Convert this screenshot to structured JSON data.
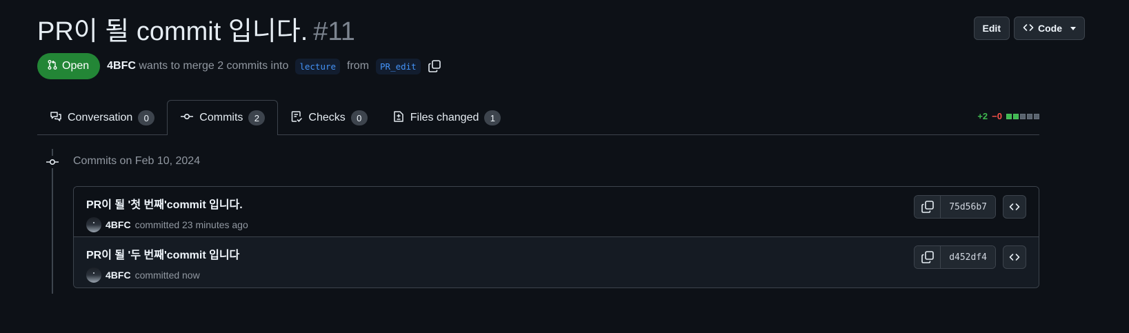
{
  "pr": {
    "title": "PR이 될 commit 입니다.",
    "number": "#11",
    "state_label": "Open",
    "author": "4BFC",
    "merge_text": "wants to merge 2 commits into",
    "base_branch": "lecture",
    "from_text": "from",
    "head_branch": "PR_edit"
  },
  "header_actions": {
    "edit_label": "Edit",
    "code_label": "Code"
  },
  "tabs": [
    {
      "label": "Conversation",
      "count": "0",
      "icon": "comment-discussion-icon"
    },
    {
      "label": "Commits",
      "count": "2",
      "icon": "git-commit-icon",
      "active": true
    },
    {
      "label": "Checks",
      "count": "0",
      "icon": "checklist-icon"
    },
    {
      "label": "Files changed",
      "count": "1",
      "icon": "file-diff-icon"
    }
  ],
  "diffstat": {
    "additions": "+2",
    "deletions": "−0",
    "blocks": [
      "added",
      "added",
      "neutral",
      "neutral",
      "neutral"
    ]
  },
  "timeline": {
    "heading": "Commits on Feb 10, 2024"
  },
  "commits": [
    {
      "message": "PR이 될 '첫 번째'commit 입니다.",
      "author": "4BFC",
      "action": "committed 23 minutes ago",
      "sha": "75d56b7"
    },
    {
      "message": "PR이 될 '두 번째'commit 입니다",
      "author": "4BFC",
      "action": "committed now",
      "sha": "d452df4"
    }
  ],
  "colors": {
    "background": "#0d1117",
    "open_badge": "#238636",
    "addition": "#3fb950",
    "deletion": "#f85149",
    "branch_link": "#4493f8"
  }
}
